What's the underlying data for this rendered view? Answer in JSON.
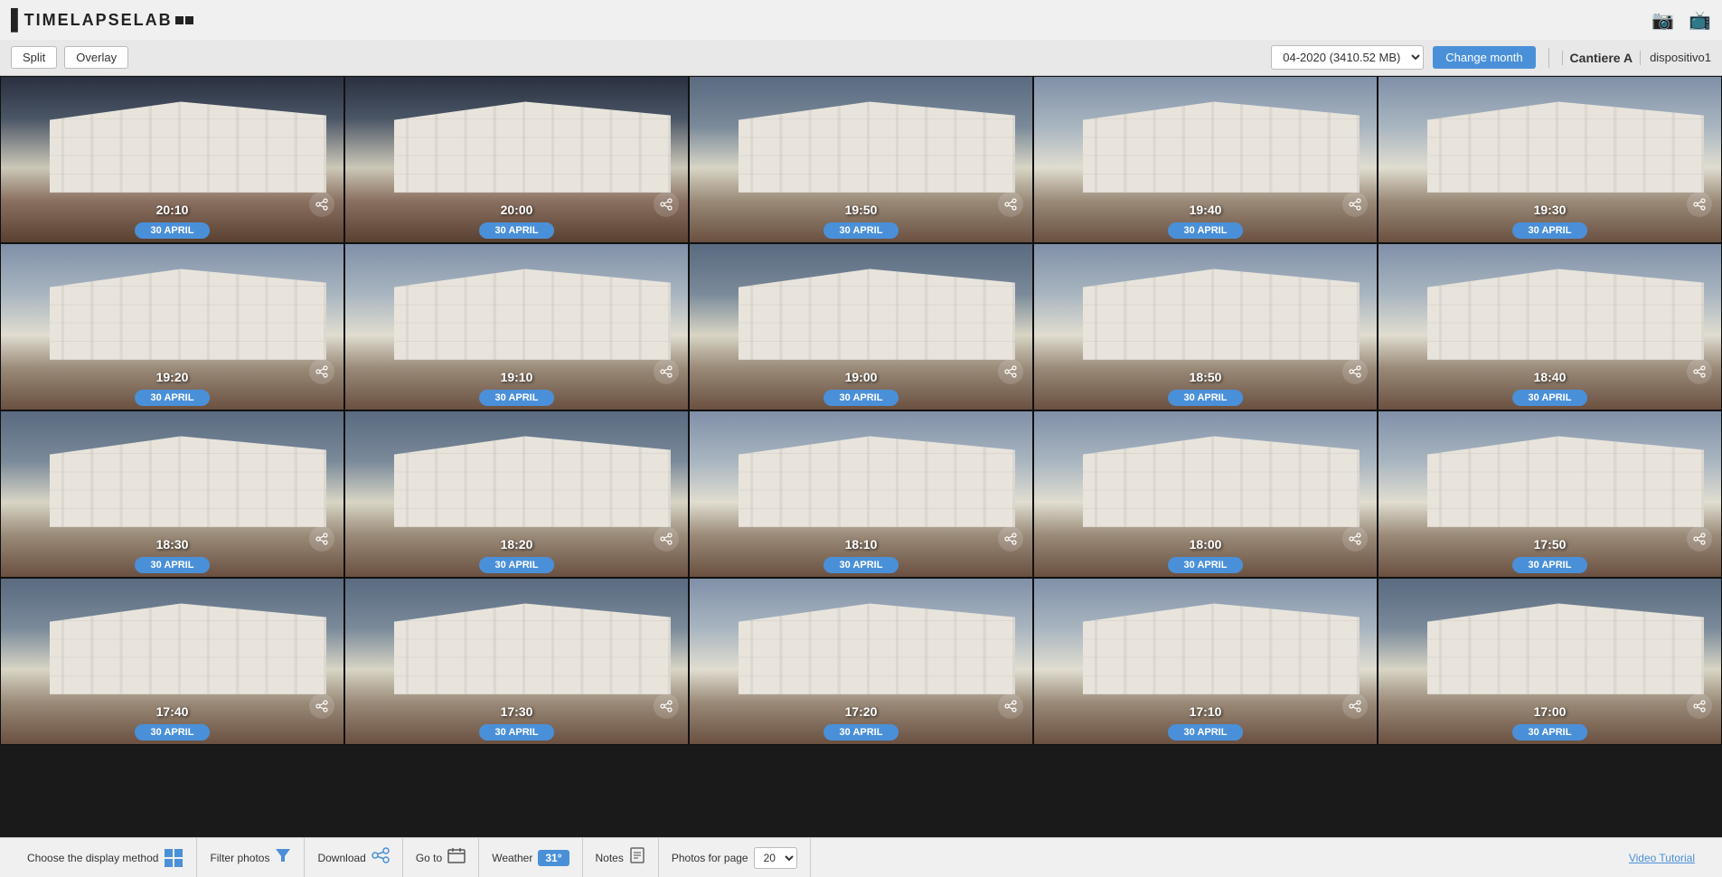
{
  "app": {
    "name": "TIMELAPSELAB",
    "logo_left_bar": "▌",
    "logo_squares": [
      "■",
      "■"
    ]
  },
  "toolbar": {
    "split_label": "Split",
    "overlay_label": "Overlay",
    "month_value": "04-2020 (3410.52 MB)",
    "change_month_label": "Change month",
    "site_name": "Cantiere A",
    "device_name": "dispositivo1"
  },
  "photos": [
    {
      "time": "20:10",
      "date": "30 APRIL",
      "sky": "dark"
    },
    {
      "time": "20:00",
      "date": "30 APRIL",
      "sky": "dark"
    },
    {
      "time": "19:50",
      "date": "30 APRIL",
      "sky": "med"
    },
    {
      "time": "19:40",
      "date": "30 APRIL",
      "sky": "light"
    },
    {
      "time": "19:30",
      "date": "30 APRIL",
      "sky": "light"
    },
    {
      "time": "19:20",
      "date": "30 APRIL",
      "sky": "light"
    },
    {
      "time": "19:10",
      "date": "30 APRIL",
      "sky": "light"
    },
    {
      "time": "19:00",
      "date": "30 APRIL",
      "sky": "med"
    },
    {
      "time": "18:50",
      "date": "30 APRIL",
      "sky": "light"
    },
    {
      "time": "18:40",
      "date": "30 APRIL",
      "sky": "light"
    },
    {
      "time": "18:30",
      "date": "30 APRIL",
      "sky": "med"
    },
    {
      "time": "18:20",
      "date": "30 APRIL",
      "sky": "med"
    },
    {
      "time": "18:10",
      "date": "30 APRIL",
      "sky": "light"
    },
    {
      "time": "18:00",
      "date": "30 APRIL",
      "sky": "light"
    },
    {
      "time": "17:50",
      "date": "30 APRIL",
      "sky": "light"
    },
    {
      "time": "17:40",
      "date": "30 APRIL",
      "sky": "med"
    },
    {
      "time": "17:30",
      "date": "30 APRIL",
      "sky": "med"
    },
    {
      "time": "17:20",
      "date": "30 APRIL",
      "sky": "light"
    },
    {
      "time": "17:10",
      "date": "30 APRIL",
      "sky": "light"
    },
    {
      "time": "17:00",
      "date": "30 APRIL",
      "sky": "med"
    }
  ],
  "bottom_bar": {
    "choose_display_label": "Choose the display method",
    "filter_photos_label": "Filter photos",
    "download_label": "Download",
    "goto_label": "Go to",
    "weather_label": "Weather",
    "weather_temp": "31°",
    "notes_label": "Notes",
    "photos_per_page_label": "Photos for page",
    "photos_per_page_value": "20",
    "video_tutorial_label": "Video Tutorial"
  }
}
